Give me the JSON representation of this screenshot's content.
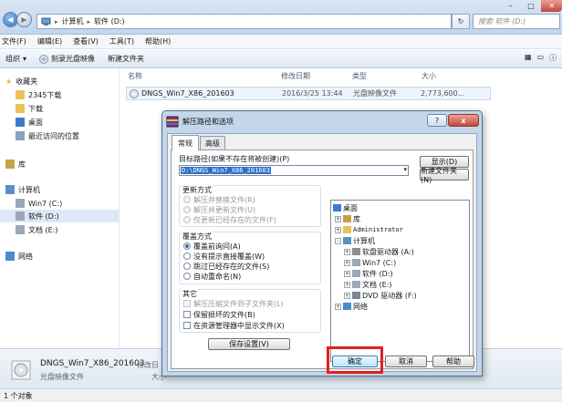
{
  "explorer": {
    "path": [
      "计算机",
      "软件 (D:)"
    ],
    "search_placeholder": "搜索 软件 (D:)",
    "menu": [
      "文件(F)",
      "编辑(E)",
      "查看(V)",
      "工具(T)",
      "帮助(H)"
    ],
    "toolbar": [
      "组织",
      "刻录光盘映像",
      "新建文件夹"
    ],
    "sidebar": {
      "favorites_header": "收藏夹",
      "favorites": [
        "2345下载",
        "下载",
        "桌面",
        "最近访问的位置"
      ],
      "libraries_header": "库",
      "computer_header": "计算机",
      "drives": [
        "Win7 (C:)",
        "软件 (D:)",
        "文档 (E:)"
      ],
      "network": "网络"
    },
    "columns": [
      "名称",
      "修改日期",
      "类型",
      "大小"
    ],
    "files": [
      {
        "name": "DNGS_Win7_X86_201603",
        "date": "2016/3/25 13:44",
        "type": "光盘映像文件",
        "size": "2,773,600..."
      }
    ],
    "details": {
      "name": "DNGS_Win7_X86_201603",
      "type": "光盘映像文件",
      "modified_label": "修改日",
      "size_label": "大小"
    },
    "status": "1 个对象"
  },
  "dialog": {
    "title": "解压路径和选项",
    "help_glyph": "?",
    "close_glyph": "x",
    "tabs": [
      "常规",
      "高级"
    ],
    "target_label": "目标路径(如果不存在将被创建)(P)",
    "target_value": "D:\\DNGS_Win7_X86_201603",
    "show_button": "显示(D)",
    "new_folder_button": "新建文件夹(N)",
    "update_mode": {
      "label": "更新方式",
      "options": [
        "解压并替换文件(R)",
        "解压并更新文件(U)",
        "仅更新已经存在的文件(F)"
      ]
    },
    "overwrite_mode": {
      "label": "覆盖方式",
      "options": [
        "覆盖前询问(A)",
        "没有提示直接覆盖(W)",
        "跳过已经存在的文件(S)",
        "自动重命名(N)"
      ],
      "selected": 0
    },
    "misc": {
      "label": "其它",
      "options": [
        "解压压缩文件到子文件夹(L)",
        "保留损坏的文件(B)",
        "在资源管理器中显示文件(X)"
      ],
      "disabled": [
        0
      ]
    },
    "save_button": "保存设置(V)",
    "tree": [
      {
        "label": "桌面",
        "level": 0,
        "expander": ""
      },
      {
        "label": "库",
        "level": 1,
        "expander": "+"
      },
      {
        "label": "Administrator",
        "level": 1,
        "expander": "+"
      },
      {
        "label": "计算机",
        "level": 1,
        "expander": "-"
      },
      {
        "label": "软盘驱动器 (A:)",
        "level": 2,
        "expander": "+"
      },
      {
        "label": "Win7 (C:)",
        "level": 2,
        "expander": "+"
      },
      {
        "label": "软件 (D:)",
        "level": 2,
        "expander": "+"
      },
      {
        "label": "文档 (E:)",
        "level": 2,
        "expander": "+"
      },
      {
        "label": "DVD 驱动器 (F:)",
        "level": 2,
        "expander": "+"
      },
      {
        "label": "网络",
        "level": 1,
        "expander": "+"
      }
    ],
    "ok_button": "确定",
    "cancel_button": "取消",
    "help_button": "帮助"
  },
  "colors": {
    "highlight": "#e02020",
    "selection": "#2f6fc8",
    "folder": "#e8c35a"
  }
}
